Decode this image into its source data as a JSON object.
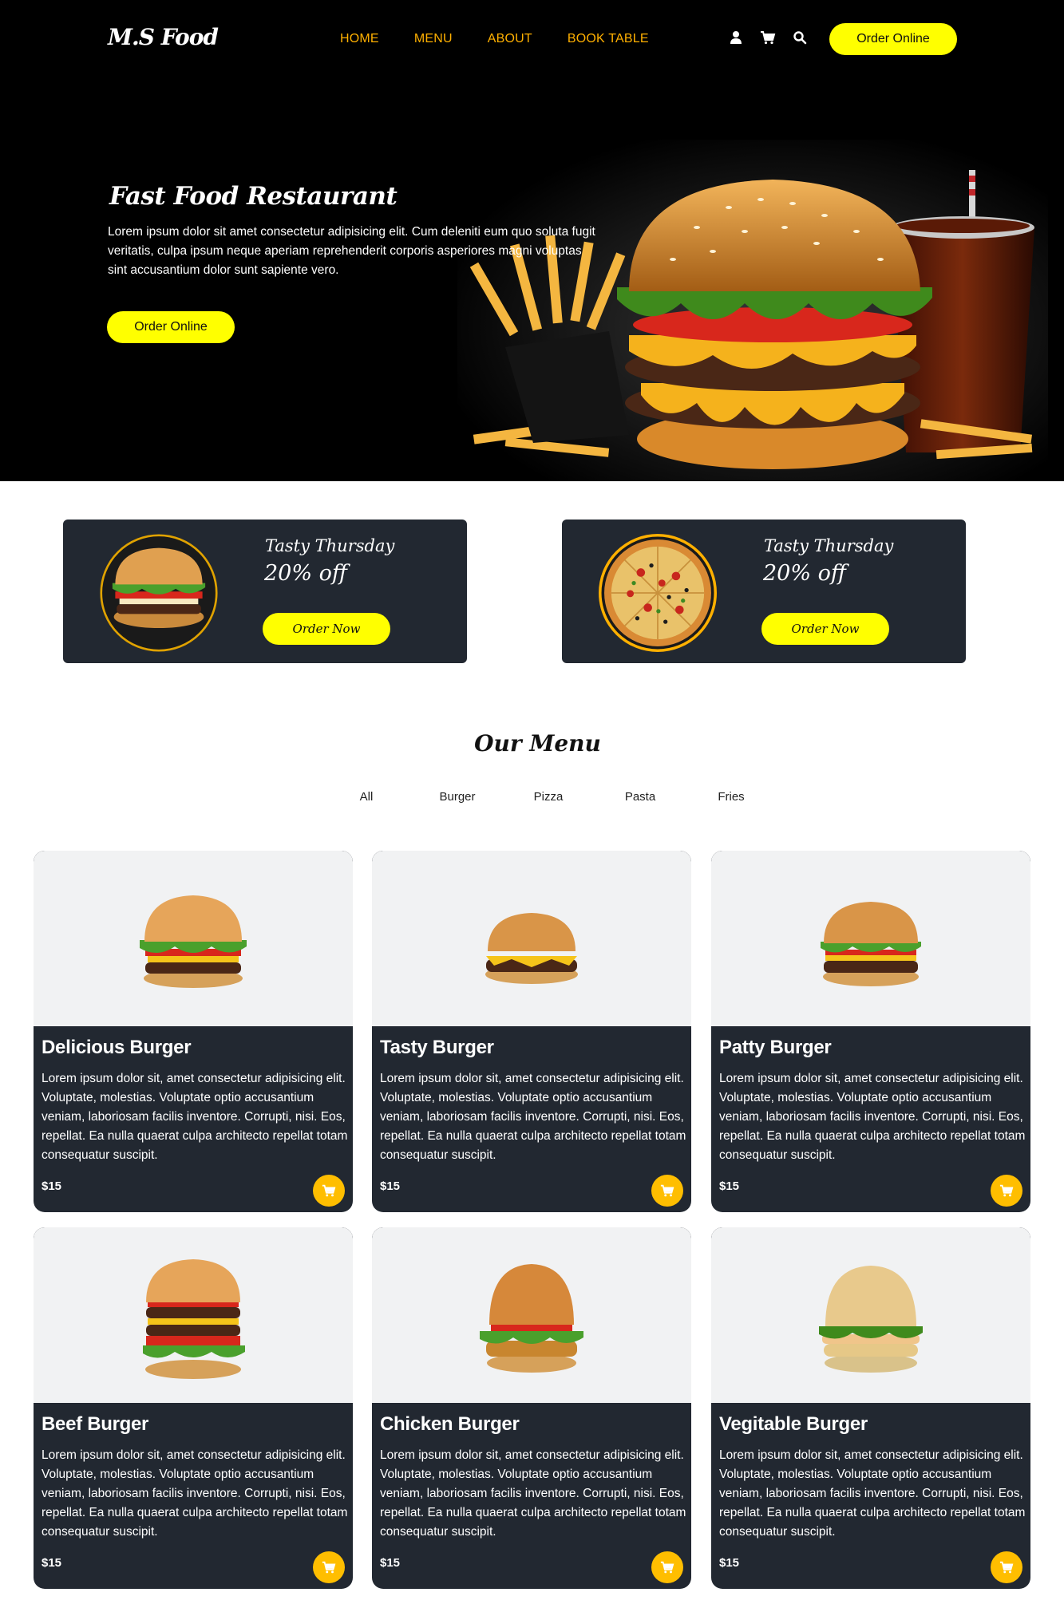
{
  "header": {
    "logo": "M.S Food",
    "nav": [
      "HOME",
      "MENU",
      "ABOUT",
      "BOOK TABLE"
    ],
    "icons": [
      "user-icon",
      "cart-icon",
      "search-icon"
    ],
    "order_label": "Order Online"
  },
  "hero": {
    "title": "Fast Food Restaurant",
    "text": "Lorem ipsum dolor sit amet consectetur adipisicing elit. Cum deleniti eum quo soluta fugit veritatis, culpa ipsum neque aperiam reprehenderit corporis asperiores magni voluptas sint accusantium dolor sunt sapiente vero.",
    "order_label": "Order Online"
  },
  "offers": [
    {
      "title": "Tasty Thursday",
      "discount": "20% off",
      "button": "Order Now",
      "image": "burger"
    },
    {
      "title": "Tasty Thursday",
      "discount": "20% off",
      "button": "Order Now",
      "image": "pizza"
    }
  ],
  "menu": {
    "heading": "Our Menu",
    "filters": [
      "All",
      "Burger",
      "Pizza",
      "Pasta",
      "Fries"
    ],
    "items": [
      {
        "name": "Delicious Burger",
        "desc": "Lorem ipsum dolor sit, amet consectetur adipisicing elit. Voluptate, molestias. Voluptate optio accusantium veniam, laboriosam facilis inventore. Corrupti, nisi. Eos, repellat. Ea nulla quaerat culpa architecto repellat totam consequatur suscipit.",
        "price": "$15"
      },
      {
        "name": "Tasty Burger",
        "desc": "Lorem ipsum dolor sit, amet consectetur adipisicing elit. Voluptate, molestias. Voluptate optio accusantium veniam, laboriosam facilis inventore. Corrupti, nisi. Eos, repellat. Ea nulla quaerat culpa architecto repellat totam consequatur suscipit.",
        "price": "$15"
      },
      {
        "name": "Patty Burger",
        "desc": "Lorem ipsum dolor sit, amet consectetur adipisicing elit. Voluptate, molestias. Voluptate optio accusantium veniam, laboriosam facilis inventore. Corrupti, nisi. Eos, repellat. Ea nulla quaerat culpa architecto repellat totam consequatur suscipit.",
        "price": "$15"
      },
      {
        "name": "Beef Burger",
        "desc": "Lorem ipsum dolor sit, amet consectetur adipisicing elit. Voluptate, molestias. Voluptate optio accusantium veniam, laboriosam facilis inventore. Corrupti, nisi. Eos, repellat. Ea nulla quaerat culpa architecto repellat totam consequatur suscipit.",
        "price": "$15"
      },
      {
        "name": "Chicken Burger",
        "desc": "Lorem ipsum dolor sit, amet consectetur adipisicing elit. Voluptate, molestias. Voluptate optio accusantium veniam, laboriosam facilis inventore. Corrupti, nisi. Eos, repellat. Ea nulla quaerat culpa architecto repellat totam consequatur suscipit.",
        "price": "$15"
      },
      {
        "name": "Vegitable Burger",
        "desc": "Lorem ipsum dolor sit, amet consectetur adipisicing elit. Voluptate, molestias. Voluptate optio accusantium veniam, laboriosam facilis inventore. Corrupti, nisi. Eos, repellat. Ea nulla quaerat culpa architecto repellat totam consequatur suscipit.",
        "price": "$15"
      }
    ]
  },
  "colors": {
    "accent": "#ffff00",
    "nav_link": "#ffb000",
    "card_bg": "#222831",
    "cart_button": "#ffbe00"
  }
}
